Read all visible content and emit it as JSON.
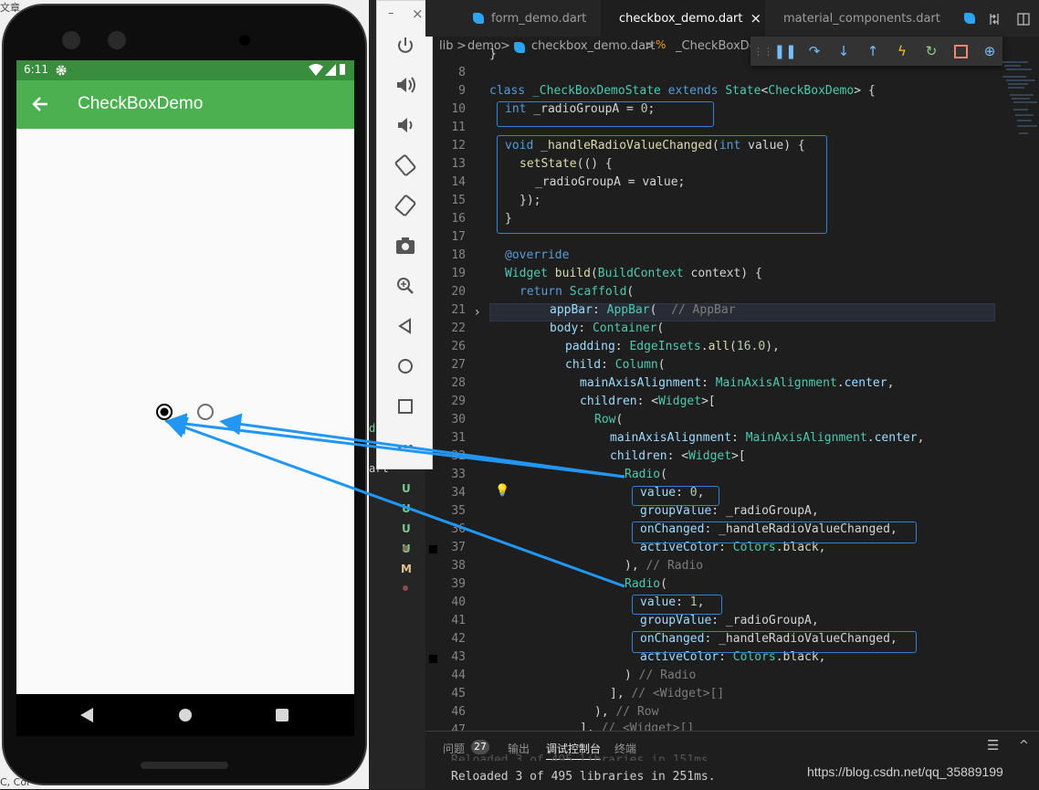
{
  "window": {
    "corner_label": "文章",
    "corner_bottom": "C, Cor"
  },
  "phone": {
    "status_time": "6:11",
    "app_title": "CheckBoxDemo",
    "radio_selected": 0
  },
  "emulator": {
    "buttons": [
      "power-icon",
      "volume-up-icon",
      "volume-down-icon",
      "rotate-left-icon",
      "rotate-right-icon",
      "camera-icon",
      "zoom-icon",
      "back-icon",
      "home-icon",
      "overview-icon",
      "more-icon"
    ],
    "minimize": "–",
    "close": "×"
  },
  "explorer_markers": [
    "d",
    "art",
    "U",
    "U",
    "U",
    "U",
    "•",
    "M",
    "•"
  ],
  "tabs": [
    {
      "label": "form_demo.dart"
    },
    {
      "label": "checkbox_demo.dart",
      "close": "×"
    },
    {
      "label": "material_components.dart"
    }
  ],
  "breadcrumb": {
    "a": "lib",
    "b": "demo",
    "c": "checkbox_demo.dart",
    "d": "_CheckBoxDem"
  },
  "code": {
    "line_numbers": [
      "8",
      "9",
      "10",
      "11",
      "12",
      "13",
      "14",
      "15",
      "16",
      "17",
      "18",
      "19",
      "20",
      "21",
      "22",
      "26",
      "27",
      "28",
      "29",
      "30",
      "31",
      "32",
      "33",
      "34",
      "35",
      "36",
      "37",
      "38",
      "39",
      "40",
      "41",
      "42",
      "43",
      "44",
      "45",
      "46",
      "47",
      "48"
    ],
    "l8": "}",
    "l10": [
      "class ",
      "_CheckBoxDemoState",
      " extends ",
      "State",
      "<",
      "CheckBoxDemo",
      "> {"
    ],
    "l11": [
      "int",
      " _radioGroupA = ",
      "0",
      ";"
    ],
    "l13": [
      "void",
      " ",
      "_handleRadioValueChanged",
      "(",
      "int",
      " value) {"
    ],
    "l14": [
      "setState",
      "(() {"
    ],
    "l15": "_radioGroupA = value;",
    "l16": "});",
    "l17": "}",
    "l19": "@override",
    "l20": [
      "Widget",
      " ",
      "build",
      "(",
      "BuildContext",
      " context) {"
    ],
    "l21": [
      "return ",
      "Scaffold",
      "("
    ],
    "l22": [
      "appBar",
      ": ",
      "AppBar",
      "(  ",
      "// AppBar"
    ],
    "l26": [
      "body",
      ": ",
      "Container",
      "("
    ],
    "l27": [
      "padding",
      ": ",
      "EdgeInsets",
      ".",
      "all",
      "(",
      "16.0",
      "),"
    ],
    "l28": [
      "child",
      ": ",
      "Column",
      "("
    ],
    "l29": [
      "mainAxisAlignment",
      ": ",
      "MainAxisAlignment",
      ".",
      "center",
      ","
    ],
    "l30": [
      "children",
      ": <",
      "Widget",
      ">["
    ],
    "l31": [
      "Row",
      "("
    ],
    "l32": [
      "mainAxisAlignment",
      ": ",
      "MainAxisAlignment",
      ".",
      "center",
      ","
    ],
    "l33": [
      "children",
      ": <",
      "Widget",
      ">["
    ],
    "l34": [
      "Radio",
      "("
    ],
    "l35": [
      "value",
      ": ",
      "0",
      ","
    ],
    "l36": [
      "groupValue",
      ": _radioGroupA,"
    ],
    "l37": [
      "onChanged",
      ": _handleRadioValueChanged,"
    ],
    "l38": [
      "activeColor",
      ": ",
      "Colors",
      ".black,"
    ],
    "l39": [
      "),",
      " // Radio"
    ],
    "l40": [
      "Radio",
      "("
    ],
    "l41": [
      "value",
      ": ",
      "1",
      ","
    ],
    "l42": [
      "groupValue",
      ": _radioGroupA,"
    ],
    "l43": [
      "onChanged",
      ": _handleRadioValueChanged,"
    ],
    "l44": [
      "activeColor",
      ": ",
      "Colors",
      ".black,"
    ],
    "l45": [
      ")",
      " // Radio"
    ],
    "l46": [
      "],",
      " // <Widget>[]"
    ],
    "l47": [
      "),",
      " // Row"
    ],
    "l48": [
      "],",
      " // <Widget>[]"
    ]
  },
  "panel": {
    "tabs": [
      {
        "label": "问题",
        "badge": "27"
      },
      {
        "label": "输出"
      },
      {
        "label": "调试控制台"
      },
      {
        "label": "终端"
      }
    ],
    "ghost": "Reloaded 3 of 495 libraries in 151ms.",
    "output": "Reloaded 3 of 495 libraries in 251ms.",
    "watermark": "https://blog.csdn.net/qq_35889199"
  },
  "colors": {
    "appbar": "#4caf50",
    "statusbar": "#388e3c",
    "annotation": "#2196f3"
  }
}
